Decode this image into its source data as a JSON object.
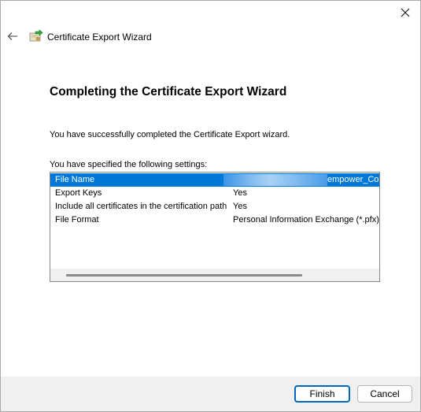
{
  "window": {
    "title": "Certificate Export Wizard"
  },
  "page": {
    "heading": "Completing the Certificate Export Wizard",
    "success_text": "You have successfully completed the Certificate Export wizard.",
    "settings_label": "You have specified the following settings:"
  },
  "settings": [
    {
      "name": "File Name",
      "value": "empower_Co",
      "selected": true,
      "value_redacted_prefix": true
    },
    {
      "name": "Export Keys",
      "value": "Yes",
      "selected": false
    },
    {
      "name": "Include all certificates in the certification path",
      "value": "Yes",
      "selected": false
    },
    {
      "name": "File Format",
      "value": "Personal Information Exchange (*.pfx)",
      "selected": false
    }
  ],
  "buttons": {
    "finish_label": "Finish",
    "cancel_label": "Cancel"
  },
  "icons": {
    "close": "close-icon",
    "back": "back-arrow-icon",
    "app": "certificate-icon"
  },
  "colors": {
    "selection": "#0078d7",
    "footer_bg": "#f0f0f0",
    "primary_border": "#0067c0"
  }
}
